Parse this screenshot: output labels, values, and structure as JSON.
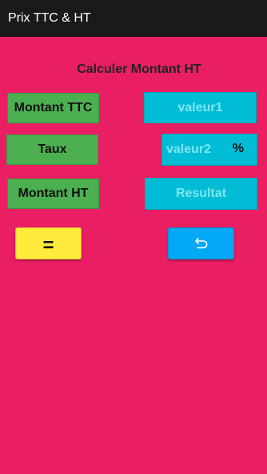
{
  "app": {
    "title": "Prix TTC & HT"
  },
  "main": {
    "heading": "Calculer Montant HT",
    "rows": [
      {
        "label": "Montant TTC",
        "placeholder": "valeur1"
      },
      {
        "label": "Taux",
        "placeholder": "valeur2",
        "suffix": "%"
      },
      {
        "label": "Montant HT",
        "placeholder": "Resultat"
      }
    ],
    "equal_button": "=",
    "reset_icon": "undo-icon"
  },
  "colors": {
    "background": "#E91E63",
    "appbar": "#1a1a1a",
    "label_box": "#4CAF50",
    "field": "#00BCD4",
    "equal_button": "#FFEB3B",
    "reset_button": "#03A9F4"
  }
}
